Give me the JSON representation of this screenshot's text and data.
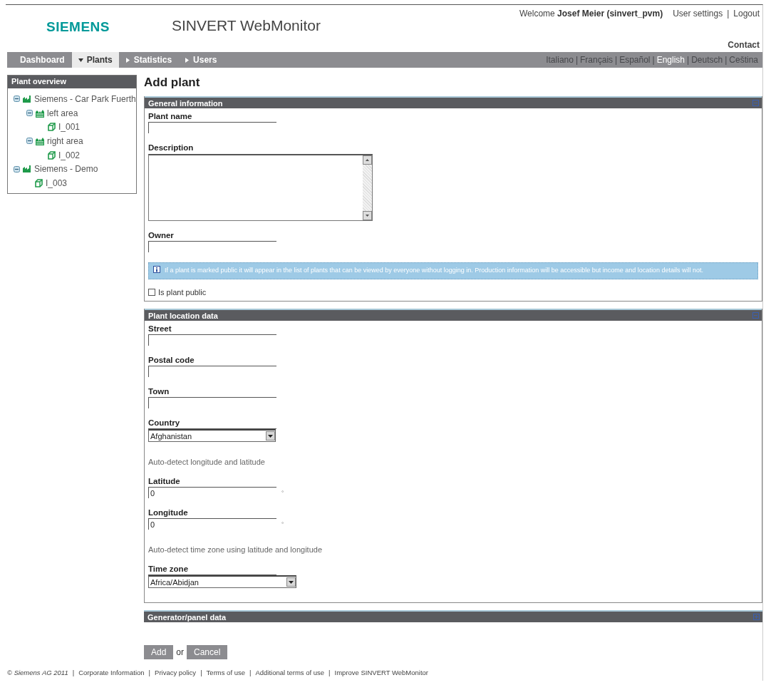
{
  "header": {
    "logo": "SIEMENS",
    "app_title": "SINVERT WebMonitor",
    "welcome": "Welcome",
    "user": "Josef Meier (sinvert_pvm)",
    "links": [
      "User settings",
      "Logout"
    ],
    "separator": "|",
    "contact": "Contact"
  },
  "nav": {
    "items": [
      {
        "label": "Dashboard",
        "kind": "plain",
        "selected": false
      },
      {
        "label": "Plants",
        "kind": "menu",
        "selected": true,
        "expanded": true
      },
      {
        "label": "Statistics",
        "kind": "menu",
        "selected": false,
        "expanded": false
      },
      {
        "label": "Users",
        "kind": "menu",
        "selected": false,
        "expanded": false
      }
    ],
    "language_separator": "|",
    "languages": [
      {
        "label": "Italiano",
        "selected": false
      },
      {
        "label": "Français",
        "selected": false
      },
      {
        "label": "Español",
        "selected": false
      },
      {
        "label": "English",
        "selected": true
      },
      {
        "label": "Deutsch",
        "selected": false
      },
      {
        "label": "Ceština",
        "selected": false
      }
    ]
  },
  "sidebar": {
    "title": "Plant overview",
    "tree": [
      {
        "label": "Siemens - Car Park Fuerth",
        "kind": "plant",
        "expanded": true,
        "children": [
          {
            "label": "left area",
            "kind": "area",
            "expanded": true,
            "children": [
              {
                "label": "I_001",
                "kind": "inverter"
              }
            ]
          },
          {
            "label": "right area",
            "kind": "area",
            "expanded": true,
            "children": [
              {
                "label": "I_002",
                "kind": "inverter"
              }
            ]
          }
        ]
      },
      {
        "label": "Siemens - Demo",
        "kind": "plant",
        "expanded": true,
        "children": [
          {
            "label": "I_003",
            "kind": "inverter"
          }
        ]
      }
    ]
  },
  "page_title": "Add plant",
  "sections": [
    {
      "title": "General information",
      "expanded": true,
      "fields": [
        {
          "kind": "text",
          "label": "Plant name"
        },
        {
          "kind": "textarea",
          "label": "Description"
        },
        {
          "kind": "text",
          "label": "Owner"
        },
        {
          "kind": "info",
          "text": "If a plant is marked public it will appear in the list of plants that can be viewed by everyone without logging in. Production information will be accessible but income and location details will not."
        },
        {
          "kind": "checkbox",
          "label": "Is plant public",
          "checked": false
        }
      ]
    },
    {
      "title": "Plant location data",
      "expanded": true,
      "fields": [
        {
          "kind": "text",
          "label": "Street"
        },
        {
          "kind": "text",
          "label": "Postal code"
        },
        {
          "kind": "text",
          "label": "Town"
        },
        {
          "kind": "select",
          "label": "Country",
          "value": "Afghanistan"
        },
        {
          "kind": "note",
          "text": "Auto-detect longitude and latitude"
        },
        {
          "kind": "text",
          "label": "Latitude",
          "value": "0",
          "unit": "°"
        },
        {
          "kind": "text",
          "label": "Longitude",
          "value": "0",
          "unit": "°"
        },
        {
          "kind": "note",
          "text": "Auto-detect time zone using latitude and longitude"
        },
        {
          "kind": "select",
          "label": "Time zone",
          "value": "Africa/Abidjan",
          "wide": true
        }
      ]
    },
    {
      "title": "Generator/panel data",
      "expanded": false
    }
  ],
  "actions": {
    "primary": "Add",
    "separator": "or",
    "secondary": "Cancel"
  },
  "footer": {
    "copyright": "© Siemens AG 2011",
    "separator": "|",
    "links": [
      "Corporate Information",
      "Privacy policy",
      "Terms of use",
      "Additional terms of use",
      "Improve SINVERT WebMonitor"
    ]
  }
}
